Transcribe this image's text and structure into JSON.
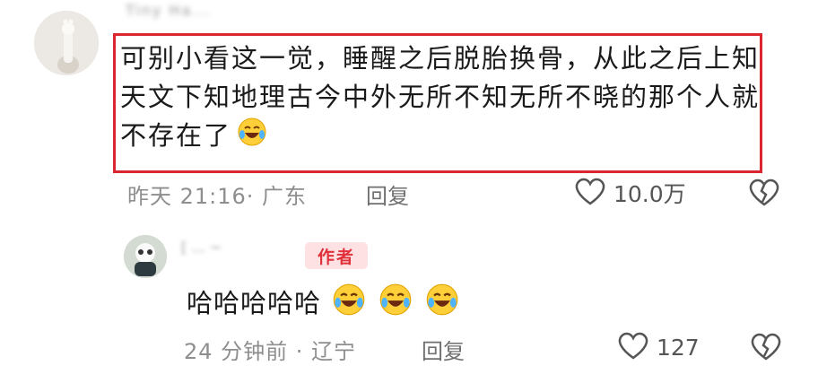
{
  "comment1": {
    "username": "Tiny Ha...",
    "text": "可别小看这一觉，睡醒之后脱胎换骨，从此之后上知天文下知地理古今中外无所不知无所不晓的那个人就不存在了",
    "emoji": "laughing-tears-icon",
    "time": "昨天 21:16",
    "location": "广东",
    "meta": "昨天 21:16· 广东",
    "reply_label": "回复",
    "like_count": "10.0万",
    "highlight_color": "#d9262f"
  },
  "comment2": {
    "username": "[ ... ~",
    "badge": "作者",
    "text": "哈哈哈哈哈",
    "emoji_count": 3,
    "meta": "24 分钟前 · 辽宁",
    "reply_label": "回复",
    "like_count": "127"
  },
  "colors": {
    "badge_bg": "#fde1e3",
    "badge_text": "#e0303a"
  }
}
